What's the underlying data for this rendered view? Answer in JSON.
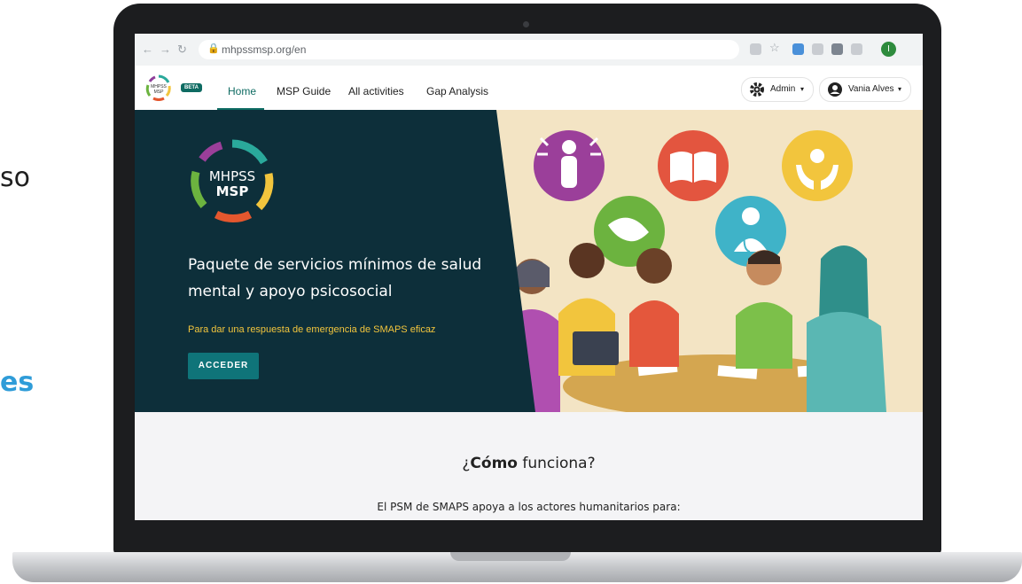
{
  "side": {
    "text_top": "so",
    "text_bottom": "es"
  },
  "browser": {
    "url": "mhpssmsp.org/en",
    "profile_initial": "I"
  },
  "app": {
    "beta_label": "BETA",
    "logo_text_top": "MHPSS",
    "logo_text_bottom": "MSP",
    "nav": [
      {
        "label": "Home",
        "active": true
      },
      {
        "label": "MSP Guide",
        "active": false
      },
      {
        "label": "All activities",
        "active": false
      },
      {
        "label": "Gap Analysis",
        "active": false
      }
    ],
    "admin_label": "Admin",
    "user_label": "Vania Alves"
  },
  "hero": {
    "logo_text_top": "MHPSS",
    "logo_text_bottom": "MSP",
    "title": "Paquete de servicios mínimos de salud mental y apoyo psicosocial",
    "subtitle": "Para dar una respuesta de emergencia de SMAPS eficaz",
    "button_label": "ACCEDER"
  },
  "section": {
    "title_prefix": "¿",
    "title_bold": "Cómo",
    "title_rest": " funciona?",
    "body": "El PSM de SMAPS apoya a los actores humanitarios para:"
  },
  "colors": {
    "teal": "#0e6b62",
    "hero_bg": "#0d2f3a",
    "accent_yellow": "#f2c53d",
    "side_blue": "#2f9cd8"
  }
}
